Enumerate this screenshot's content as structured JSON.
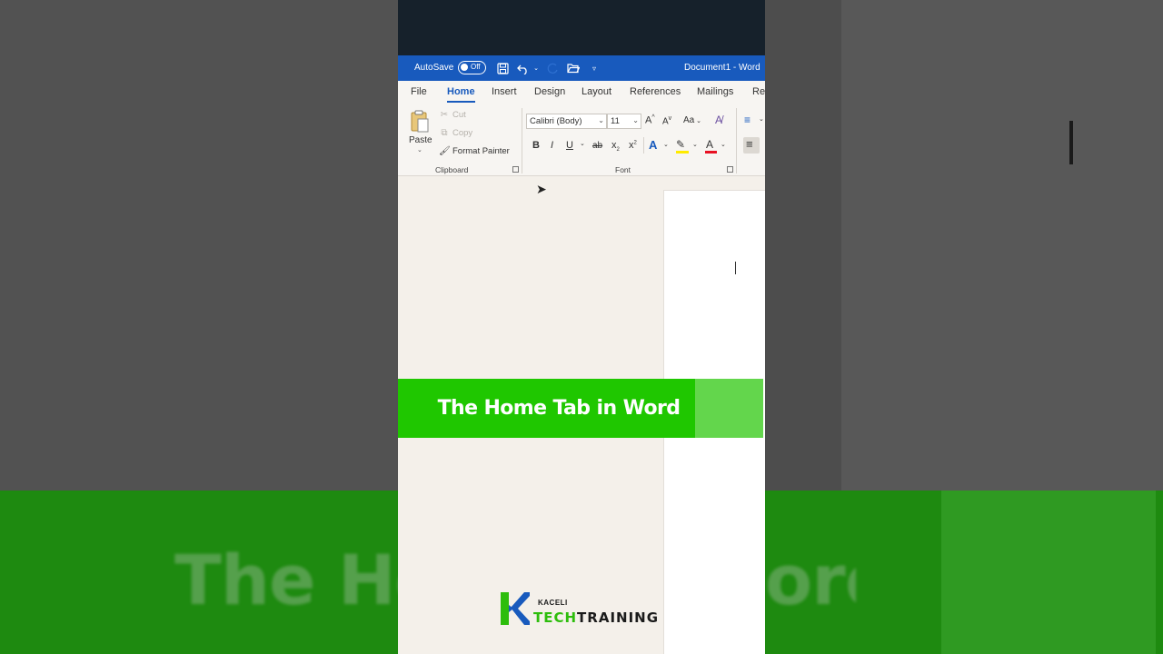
{
  "titlebar": {
    "autosave_label": "AutoSave",
    "autosave_state": "Off",
    "document_title": "Document1  -  Word"
  },
  "tabs": [
    {
      "label": "File",
      "active": false
    },
    {
      "label": "Home",
      "active": true
    },
    {
      "label": "Insert",
      "active": false
    },
    {
      "label": "Design",
      "active": false
    },
    {
      "label": "Layout",
      "active": false
    },
    {
      "label": "References",
      "active": false
    },
    {
      "label": "Mailings",
      "active": false
    },
    {
      "label": "Re",
      "active": false
    }
  ],
  "ribbon": {
    "clipboard": {
      "paste_label": "Paste",
      "cut_label": "Cut",
      "copy_label": "Copy",
      "format_painter_label": "Format Painter",
      "group_label": "Clipboard"
    },
    "font": {
      "font_name": "Calibri (Body)",
      "font_size": "11",
      "grow_label": "A",
      "shrink_label": "A",
      "change_case_label": "Aa",
      "bold_label": "B",
      "italic_label": "I",
      "underline_label": "U",
      "strike_label": "ab",
      "subscript_label": "x",
      "superscript_label": "x",
      "text_effects_label": "A",
      "font_color_label": "A",
      "group_label": "Font"
    },
    "colors": {
      "highlight": "#ffeb00",
      "font_color": "#e81123",
      "text_effects": "#185abd"
    }
  },
  "banner": {
    "text": "The Home Tab in Word"
  },
  "logo": {
    "small_text": "KACELI",
    "tech_text": "TECH",
    "training_text": "TRAINING"
  },
  "background": {
    "blurred_text_left": "The Hor",
    "blurred_text_right": "ord"
  },
  "colors": {
    "word_blue": "#185abd",
    "banner_green": "#1fc700",
    "logo_green": "#2dbd0c"
  }
}
